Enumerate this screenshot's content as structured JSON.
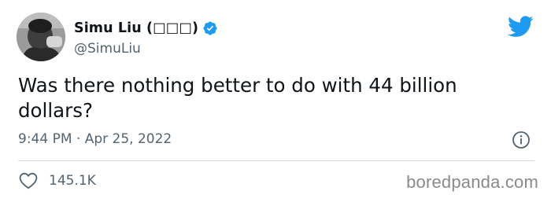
{
  "tweet": {
    "display_name": "Simu Liu (□□□)",
    "handle": "@SimuLiu",
    "text": "Was there nothing better to do with 44 billion dollars?",
    "time": "9:44 PM",
    "separator": "·",
    "date": "Apr 25, 2022",
    "likes": "145.1K"
  },
  "icons": {
    "verified": "verified-badge-icon",
    "brand": "twitter-bird-icon",
    "info": "info-icon",
    "like": "heart-icon"
  },
  "colors": {
    "verified_blue": "#1d9bf0",
    "twitter_blue": "#1d9bf0",
    "secondary_text": "#536471"
  },
  "watermark": "boredpanda.com"
}
